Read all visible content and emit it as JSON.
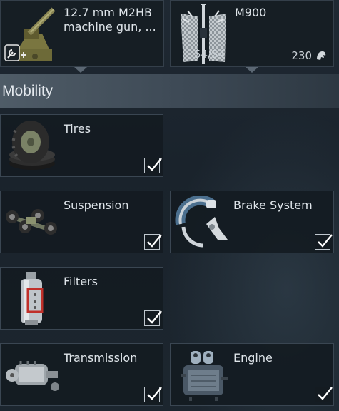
{
  "weapons": [
    {
      "label": "12.7 mm M2HB\nmachine gun, ...",
      "icon": "machine-gun-icon"
    },
    {
      "label": "M900",
      "icon": "apfsds-shell-icon",
      "ammo_count": "54/54",
      "price": "230",
      "price_icon": "silver-lion-icon"
    }
  ],
  "section": {
    "title": "Mobility"
  },
  "modules": [
    {
      "label": "Tires",
      "icon": "tires-icon",
      "checked": true
    },
    {
      "label": "Suspension",
      "icon": "suspension-icon",
      "checked": true
    },
    {
      "label": "Brake System",
      "icon": "brake-system-icon",
      "checked": true
    },
    {
      "label": "Filters",
      "icon": "filters-icon",
      "checked": true
    },
    {
      "label": "Transmission",
      "icon": "transmission-icon",
      "checked": true
    },
    {
      "label": "Engine",
      "icon": "engine-icon",
      "checked": true
    }
  ],
  "colors": {
    "card_border": "#3a4652",
    "section_bar": "#4f5c67",
    "check_border": "#bfc7ce",
    "filter_accent": "#c0302a"
  }
}
